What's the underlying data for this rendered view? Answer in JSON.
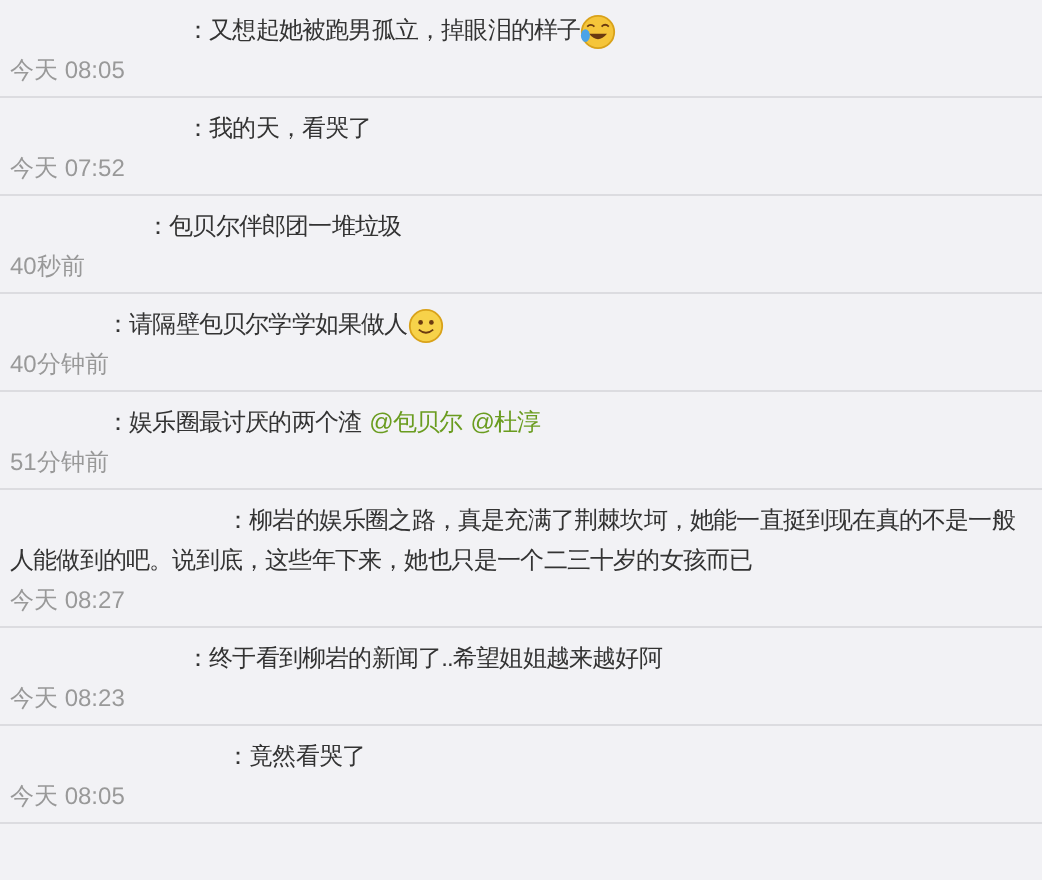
{
  "comments": [
    {
      "segments": [
        {
          "kind": "text",
          "text": "：又想起她被跑男孤立，掉眼泪的样子"
        },
        {
          "kind": "tears-emoji"
        }
      ],
      "time": "今天 08:05"
    },
    {
      "segments": [
        {
          "kind": "text",
          "text": "：我的天，看哭了"
        }
      ],
      "time": "今天 07:52"
    },
    {
      "segments": [
        {
          "kind": "text",
          "text": "：包贝尔伴郎团一堆垃圾"
        }
      ],
      "time": "40秒前"
    },
    {
      "segments": [
        {
          "kind": "text",
          "text": "：请隔壁包贝尔学学如果做人"
        },
        {
          "kind": "smile-emoji"
        }
      ],
      "time": "40分钟前"
    },
    {
      "segments": [
        {
          "kind": "text",
          "text": "：娱乐圈最讨厌的两个渣"
        },
        {
          "kind": "mention",
          "text": "@包贝尔"
        },
        {
          "kind": "mention",
          "text": "@杜淳"
        }
      ],
      "time": "51分钟前"
    },
    {
      "segments": [
        {
          "kind": "text",
          "text": "：柳岩的娱乐圈之路，真是充满了荆棘坎坷，她能一直挺到现在真的不是一般人能做到的吧。说到底，这些年下来，她也只是一个二三十岁的女孩而已"
        }
      ],
      "time": "今天 08:27"
    },
    {
      "segments": [
        {
          "kind": "text",
          "text": "：终于看到柳岩的新闻了..希望姐姐越来越好阿"
        }
      ],
      "time": "今天 08:23"
    },
    {
      "segments": [
        {
          "kind": "text",
          "text": "：竟然看哭了"
        }
      ],
      "time": "今天 08:05"
    }
  ]
}
